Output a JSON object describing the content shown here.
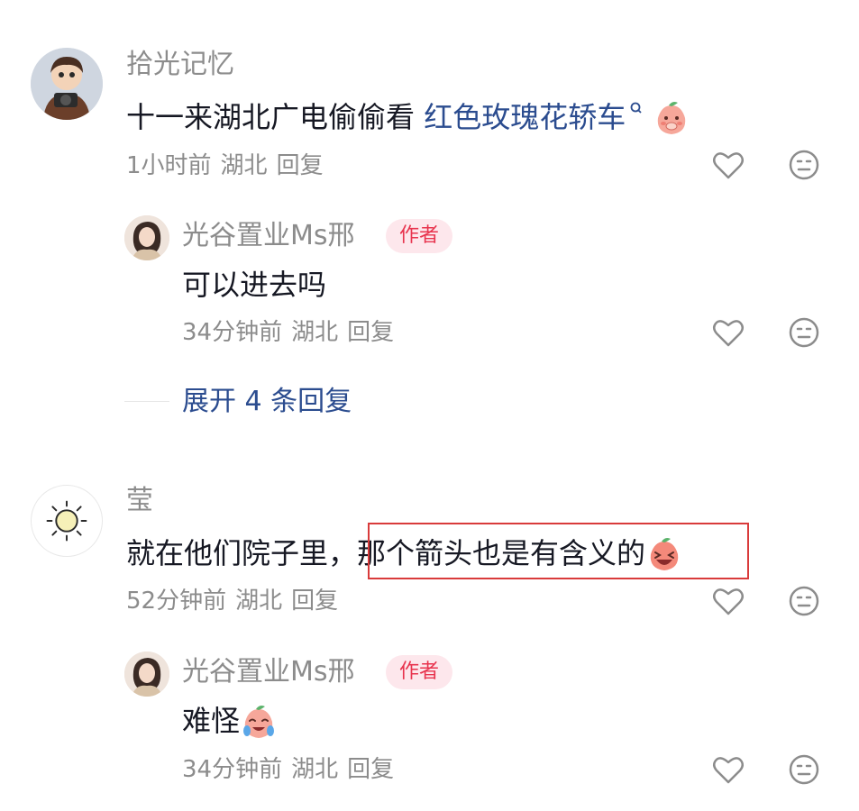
{
  "comments": [
    {
      "username": "拾光记忆",
      "text": "十一来湖北广电偷偷看 ",
      "link_text": "红色玫瑰花轿车",
      "link_icon": "search-icon",
      "trailing_emoji": "shy-peach-emoji",
      "time": "1小时前",
      "location": "湖北",
      "reply_label": "回复",
      "reply": {
        "username": "光谷置业Ms邢",
        "badge": "作者",
        "text": "可以进去吗",
        "time": "34分钟前",
        "location": "湖北",
        "reply_label": "回复"
      },
      "expand_label": "展开 4 条回复"
    },
    {
      "username": "莹",
      "text_before": "就在他们院子里，",
      "text_highlight": "那个箭头也是有含义的",
      "trailing_emoji": "laughing-peach-emoji",
      "time": "52分钟前",
      "location": "湖北",
      "reply_label": "回复",
      "reply": {
        "username": "光谷置业Ms邢",
        "badge": "作者",
        "text": "难怪",
        "trailing_emoji": "crying-laughing-peach-emoji",
        "time": "34分钟前",
        "location": "湖北",
        "reply_label": "回复"
      }
    }
  ],
  "colors": {
    "link": "#2b4c8f",
    "badge_bg": "#fde7ec",
    "badge_text": "#e8344e",
    "highlight_border": "#d93b3b",
    "meta": "#8c8c8c"
  }
}
